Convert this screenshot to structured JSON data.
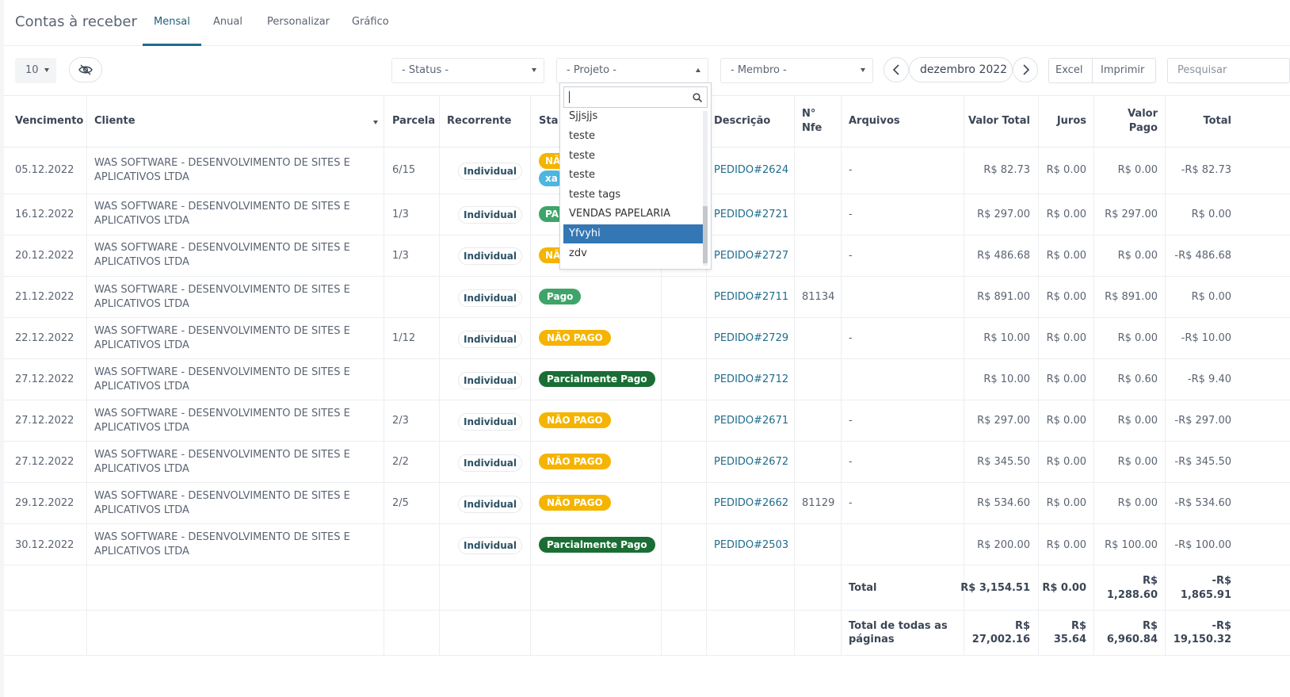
{
  "header": {
    "title": "Contas à receber",
    "tabs": [
      {
        "label": "Mensal",
        "active": true
      },
      {
        "label": "Anual"
      },
      {
        "label": "Personalizar"
      },
      {
        "label": "Gráfico"
      }
    ]
  },
  "toolbar": {
    "page_size": "10",
    "status_placeholder": "- Status -",
    "projeto_placeholder": "- Projeto -",
    "membro_placeholder": "- Membro -",
    "month": "dezembro 2022",
    "excel_label": "Excel",
    "imprimir_label": "Imprimir",
    "search_placeholder": "Pesquisar"
  },
  "columns": {
    "vencimento": "Vencimento",
    "cliente": "Cliente",
    "parcela": "Parcela",
    "recorrente": "Recorrente",
    "status": "Sta",
    "descricao": "Descrição",
    "nfe_1": "N°",
    "nfe_2": "Nfe",
    "arquivos": "Arquivos",
    "valor_total": "Valor Total",
    "juros": "Juros",
    "valor_pago_1": "Valor",
    "valor_pago_2": "Pago",
    "total": "Total"
  },
  "rows": [
    {
      "vencimento": "05.12.2022",
      "cliente_1": "WAS SOFTWARE - DESENVOLVIMENTO DE SITES E",
      "cliente_2": "APLICATIVOS LTDA",
      "parcela": "6/15",
      "recorrente": "Individual",
      "status": "NÃ",
      "status2": "xa",
      "descricao": "PEDIDO#2624",
      "nfe": "",
      "arquivos": "-",
      "valor_total": "R$ 82.73",
      "juros": "R$ 0.00",
      "valor_pago": "R$ 0.00",
      "total": "-R$ 82.73"
    },
    {
      "vencimento": "16.12.2022",
      "cliente_1": "WAS SOFTWARE - DESENVOLVIMENTO DE SITES E",
      "cliente_2": "APLICATIVOS LTDA",
      "parcela": "1/3",
      "recorrente": "Individual",
      "status": "PA",
      "descricao": "PEDIDO#2721",
      "nfe": "",
      "arquivos": "-",
      "valor_total": "R$ 297.00",
      "juros": "R$ 0.00",
      "valor_pago": "R$ 297.00",
      "total": "R$ 0.00"
    },
    {
      "vencimento": "20.12.2022",
      "cliente_1": "WAS SOFTWARE - DESENVOLVIMENTO DE SITES E",
      "cliente_2": "APLICATIVOS LTDA",
      "parcela": "1/3",
      "recorrente": "Individual",
      "status": "NÃ",
      "descricao": "PEDIDO#2727",
      "nfe": "",
      "arquivos": "-",
      "valor_total": "R$ 486.68",
      "juros": "R$ 0.00",
      "valor_pago": "R$ 0.00",
      "total": "-R$ 486.68"
    },
    {
      "vencimento": "21.12.2022",
      "cliente_1": "WAS SOFTWARE - DESENVOLVIMENTO DE SITES E",
      "cliente_2": "APLICATIVOS LTDA",
      "parcela": "",
      "recorrente": "Individual",
      "status": "Pago",
      "descricao": "PEDIDO#2711",
      "nfe": "81134",
      "arquivos": "",
      "valor_total": "R$ 891.00",
      "juros": "R$ 0.00",
      "valor_pago": "R$ 891.00",
      "total": "R$ 0.00"
    },
    {
      "vencimento": "22.12.2022",
      "cliente_1": "WAS SOFTWARE - DESENVOLVIMENTO DE SITES E",
      "cliente_2": "APLICATIVOS LTDA",
      "parcela": "1/12",
      "recorrente": "Individual",
      "status": "NÃO PAGO",
      "descricao": "PEDIDO#2729",
      "nfe": "",
      "arquivos": "-",
      "valor_total": "R$ 10.00",
      "juros": "R$ 0.00",
      "valor_pago": "R$ 0.00",
      "total": "-R$ 10.00"
    },
    {
      "vencimento": "27.12.2022",
      "cliente_1": "WAS SOFTWARE - DESENVOLVIMENTO DE SITES E",
      "cliente_2": "APLICATIVOS LTDA",
      "parcela": "",
      "recorrente": "Individual",
      "status": "Parcialmente Pago",
      "descricao": "PEDIDO#2712",
      "nfe": "",
      "arquivos": "",
      "valor_total": "R$ 10.00",
      "juros": "R$ 0.00",
      "valor_pago": "R$ 0.60",
      "total": "-R$ 9.40"
    },
    {
      "vencimento": "27.12.2022",
      "cliente_1": "WAS SOFTWARE - DESENVOLVIMENTO DE SITES E",
      "cliente_2": "APLICATIVOS LTDA",
      "parcela": "2/3",
      "recorrente": "Individual",
      "status": "NÃO PAGO",
      "descricao": "PEDIDO#2671",
      "nfe": "",
      "arquivos": "-",
      "valor_total": "R$ 297.00",
      "juros": "R$ 0.00",
      "valor_pago": "R$ 0.00",
      "total": "-R$ 297.00"
    },
    {
      "vencimento": "27.12.2022",
      "cliente_1": "WAS SOFTWARE - DESENVOLVIMENTO DE SITES E",
      "cliente_2": "APLICATIVOS LTDA",
      "parcela": "2/2",
      "recorrente": "Individual",
      "status": "NÃO PAGO",
      "descricao": "PEDIDO#2672",
      "nfe": "",
      "arquivos": "-",
      "valor_total": "R$ 345.50",
      "juros": "R$ 0.00",
      "valor_pago": "R$ 0.00",
      "total": "-R$ 345.50"
    },
    {
      "vencimento": "29.12.2022",
      "cliente_1": "WAS SOFTWARE - DESENVOLVIMENTO DE SITES E",
      "cliente_2": "APLICATIVOS LTDA",
      "parcela": "2/5",
      "recorrente": "Individual",
      "status": "NÃO PAGO",
      "descricao": "PEDIDO#2662",
      "nfe": "81129",
      "arquivos": "-",
      "valor_total": "R$ 534.60",
      "juros": "R$ 0.00",
      "valor_pago": "R$ 0.00",
      "total": "-R$ 534.60"
    },
    {
      "vencimento": "30.12.2022",
      "cliente_1": "WAS SOFTWARE - DESENVOLVIMENTO DE SITES E",
      "cliente_2": "APLICATIVOS LTDA",
      "parcela": "",
      "recorrente": "Individual",
      "status": "Parcialmente Pago",
      "descricao": "PEDIDO#2503",
      "nfe": "",
      "arquivos": "",
      "valor_total": "R$ 200.00",
      "juros": "R$ 0.00",
      "valor_pago": "R$ 100.00",
      "total": "-R$ 100.00"
    }
  ],
  "totals": {
    "label": "Total",
    "valor_total": "R$ 3,154.51",
    "juros": "R$ 0.00",
    "valor_pago_1": "R$",
    "valor_pago_2": "1,288.60",
    "total_1": "-R$",
    "total_2": "1,865.91"
  },
  "totals_all": {
    "label_1": "Total de todas as",
    "label_2": "páginas",
    "valor_total_1": "R$",
    "valor_total_2": "27,002.16",
    "juros_1": "R$",
    "juros_2": "35.64",
    "valor_pago_1": "R$",
    "valor_pago_2": "6,960.84",
    "total_1": "-R$",
    "total_2": "19,150.32"
  },
  "projeto_dropdown": {
    "search_value": "",
    "options": [
      "Sjjsjjs",
      "teste",
      "teste",
      "teste",
      "teste tags",
      "VENDAS PAPELARIA",
      "Yfvyhi",
      "zdv"
    ],
    "selected_index": 6
  },
  "colors": {
    "accent": "#1f6c8c",
    "pago": "#3fa46a",
    "nao_pago": "#f4b400",
    "parcialmente_pago": "#1a6e35",
    "selected_option": "#3477b5"
  }
}
